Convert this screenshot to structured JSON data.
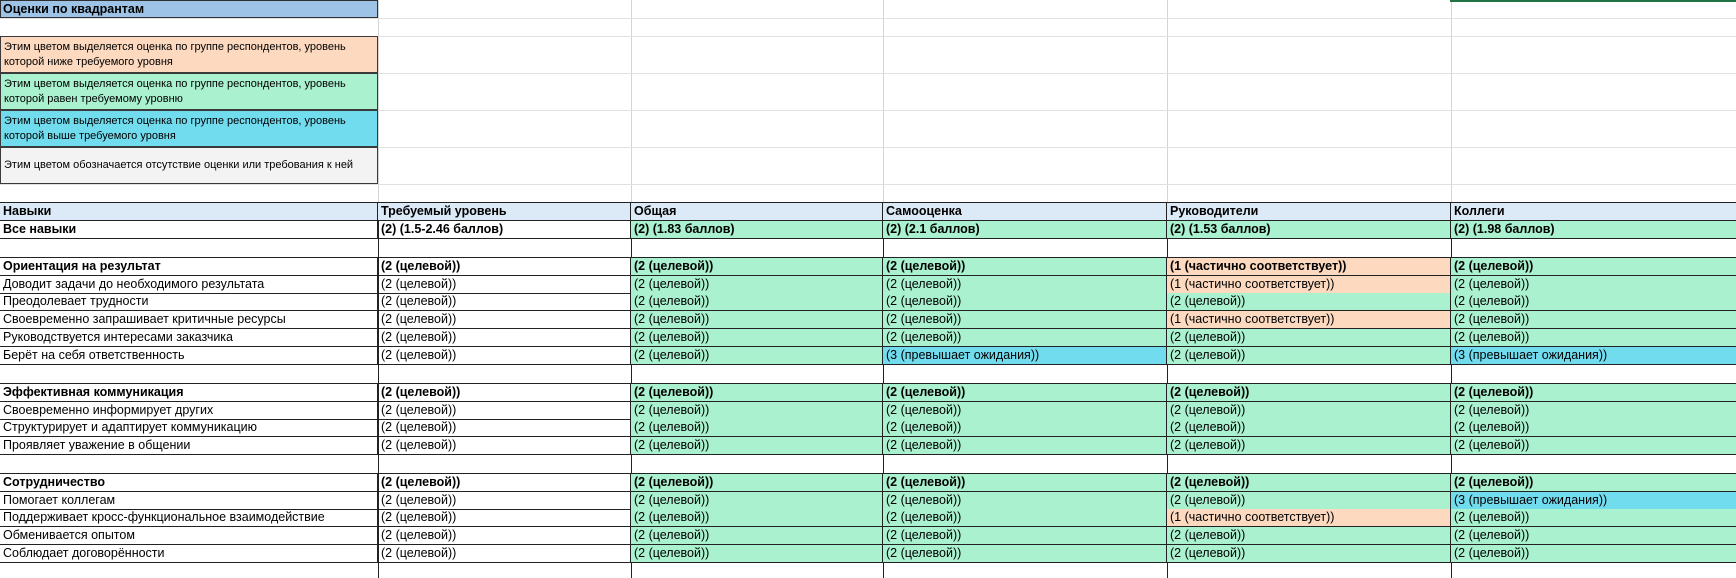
{
  "colors": {
    "title_bg": "#9dc3e6",
    "header_bg": "#dce9f6",
    "target": "#a9f1cf",
    "below": "#fcd9bf",
    "above": "#72dcef",
    "none": "#f3f3f3"
  },
  "title": "Оценки по квадрантам",
  "legend": [
    {
      "text": "Этим цветом выделяется оценка по группе респондентов, уровень которой ниже требуемого уровня",
      "color": "#fcd9bf"
    },
    {
      "text": "Этим цветом выделяется оценка по группе респондентов, уровень которой равен требуемому уровню",
      "color": "#a9f1cf"
    },
    {
      "text": "Этим цветом выделяется оценка по группе респондентов, уровень которой выше требуемого уровня",
      "color": "#72dcef"
    },
    {
      "text": "Этим цветом обозначается отсутствие оценки или требования к ней",
      "color": "#f3f3f3"
    }
  ],
  "table": {
    "headers": [
      "Навыки",
      "Требуемый уровень",
      "Общая",
      "Самооценка",
      "Руководители",
      "Коллеги"
    ],
    "total": [
      "Все навыки",
      "(2) (1.5-2.46 баллов)",
      "(2) (1.83 баллов)",
      "(2) (2.1 баллов)",
      "(2) (1.53 баллов)",
      "(2) (1.98 баллов)"
    ],
    "groups": [
      {
        "name": "Ориентация на результат",
        "values": [
          "(2 (целевой))",
          "(2 (целевой))",
          "(2 (целевой))",
          "(1 (частично соответствует))",
          "(2 (целевой))"
        ],
        "items": [
          {
            "name": "Доводит задачи до необходимого результата",
            "values": [
              "(2 (целевой))",
              "(2 (целевой))",
              "(2 (целевой))",
              "(1 (частично соответствует))",
              "(2 (целевой))"
            ]
          },
          {
            "name": "Преодолевает трудности",
            "values": [
              "(2 (целевой))",
              "(2 (целевой))",
              "(2 (целевой))",
              "(2 (целевой))",
              "(2 (целевой))"
            ]
          },
          {
            "name": "Своевременно запрашивает критичные ресурсы",
            "values": [
              "(2 (целевой))",
              "(2 (целевой))",
              "(2 (целевой))",
              "(1 (частично соответствует))",
              "(2 (целевой))"
            ]
          },
          {
            "name": "Руководствуется интересами заказчика",
            "values": [
              "(2 (целевой))",
              "(2 (целевой))",
              "(2 (целевой))",
              "(2 (целевой))",
              "(2 (целевой))"
            ]
          },
          {
            "name": "Берёт на себя ответственность",
            "values": [
              "(2 (целевой))",
              "(2 (целевой))",
              "(3 (превышает ожидания))",
              "(2 (целевой))",
              "(3 (превышает ожидания))"
            ]
          }
        ]
      },
      {
        "name": "Эффективная коммуникация",
        "values": [
          "(2 (целевой))",
          "(2 (целевой))",
          "(2 (целевой))",
          "(2 (целевой))",
          "(2 (целевой))"
        ],
        "items": [
          {
            "name": "Своевременно информирует других",
            "values": [
              "(2 (целевой))",
              "(2 (целевой))",
              "(2 (целевой))",
              "(2 (целевой))",
              "(2 (целевой))"
            ]
          },
          {
            "name": "Структурирует и адаптирует коммуникацию",
            "values": [
              "(2 (целевой))",
              "(2 (целевой))",
              "(2 (целевой))",
              "(2 (целевой))",
              "(2 (целевой))"
            ]
          },
          {
            "name": "Проявляет уважение в общении",
            "values": [
              "(2 (целевой))",
              "(2 (целевой))",
              "(2 (целевой))",
              "(2 (целевой))",
              "(2 (целевой))"
            ]
          }
        ]
      },
      {
        "name": "Сотрудничество",
        "values": [
          "(2 (целевой))",
          "(2 (целевой))",
          "(2 (целевой))",
          "(2 (целевой))",
          "(2 (целевой))"
        ],
        "items": [
          {
            "name": "Помогает коллегам",
            "values": [
              "(2 (целевой))",
              "(2 (целевой))",
              "(2 (целевой))",
              "(2 (целевой))",
              "(3 (превышает ожидания))"
            ]
          },
          {
            "name": "Поддерживает кросс-функциональное взаимодействие",
            "values": [
              "(2 (целевой))",
              "(2 (целевой))",
              "(2 (целевой))",
              "(1 (частично соответствует))",
              "(2 (целевой))"
            ]
          },
          {
            "name": "Обменивается опытом",
            "values": [
              "(2 (целевой))",
              "(2 (целевой))",
              "(2 (целевой))",
              "(2 (целевой))",
              "(2 (целевой))"
            ]
          },
          {
            "name": "Соблюдает договорённости",
            "values": [
              "(2 (целевой))",
              "(2 (целевой))",
              "(2 (целевой))",
              "(2 (целевой))",
              "(2 (целевой))"
            ]
          }
        ]
      }
    ]
  }
}
